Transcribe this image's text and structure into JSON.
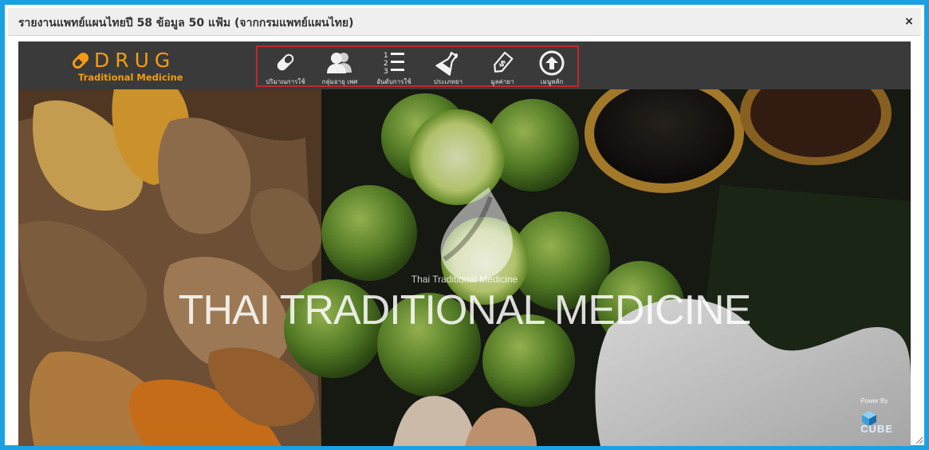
{
  "dialog": {
    "title": "รายงานแพทย์แผนไทยปี 58 ข้อมูล 50 แฟ้ม (จากกรมแพทย์แผนไทย)",
    "close_label": "×"
  },
  "logo": {
    "word": "DRUG",
    "subtitle": "Traditional Medicine",
    "color": "#f39c12"
  },
  "nav": {
    "items": [
      {
        "icon": "pill-icon",
        "label": "ปริมาณการใช้"
      },
      {
        "icon": "users-icon",
        "label": "กลุ่มอายุ เพศ"
      },
      {
        "icon": "ordered-list-icon",
        "label": "อันดับการใช้"
      },
      {
        "icon": "flask-icon",
        "label": "ประเภทยา"
      },
      {
        "icon": "price-tag-icon",
        "label": "มูลค่ายา"
      },
      {
        "icon": "arrow-up-circle-icon",
        "label": "เมนูหลัก"
      }
    ],
    "highlight_color": "#c0282d"
  },
  "hero": {
    "small_caption": "Thai Traditional Medicine",
    "title": "THAI TRADITIONAL MEDICINE",
    "powered_by": "Power By",
    "powered_brand": "CUBE"
  },
  "colors": {
    "frame_border": "#1ba1e2",
    "header_bg": "#3a3a3a"
  }
}
